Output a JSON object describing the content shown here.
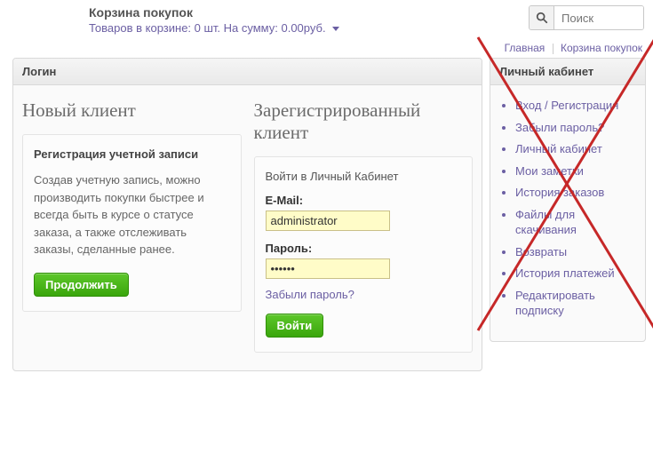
{
  "header": {
    "cart_title": "Корзина покупок",
    "cart_summary": "Товаров в корзине: 0 шт. На сумму: 0.00руб.",
    "search_placeholder": "Поиск"
  },
  "breadcrumb": {
    "home": "Главная",
    "cart": "Корзина покупок"
  },
  "login_panel": {
    "title": "Логин",
    "new_customer": {
      "heading": "Новый клиент",
      "box_title": "Регистрация учетной записи",
      "box_text": "Создав учетную запись, можно производить покупки быстрее и всегда быть в курсе о статусе заказа, а также отслеживать заказы, сделанные ранее.",
      "button": "Продолжить"
    },
    "returning": {
      "heading": "Зарегистрированный клиент",
      "intro": "Войти в Личный Кабинет",
      "email_label": "E-Mail:",
      "email_value": "administrator",
      "password_label": "Пароль:",
      "password_value": "••••••",
      "forgot": "Забыли пароль?",
      "button": "Войти"
    }
  },
  "sidebar": {
    "title": "Личный кабинет",
    "items": [
      "Вход / Регистрация",
      "Забыли пароль?",
      "Личный кабинет",
      "Мои заметки",
      "История заказов",
      "Файлы для скачивания",
      "Возвраты",
      "История платежей",
      "Редактировать подписку"
    ]
  }
}
